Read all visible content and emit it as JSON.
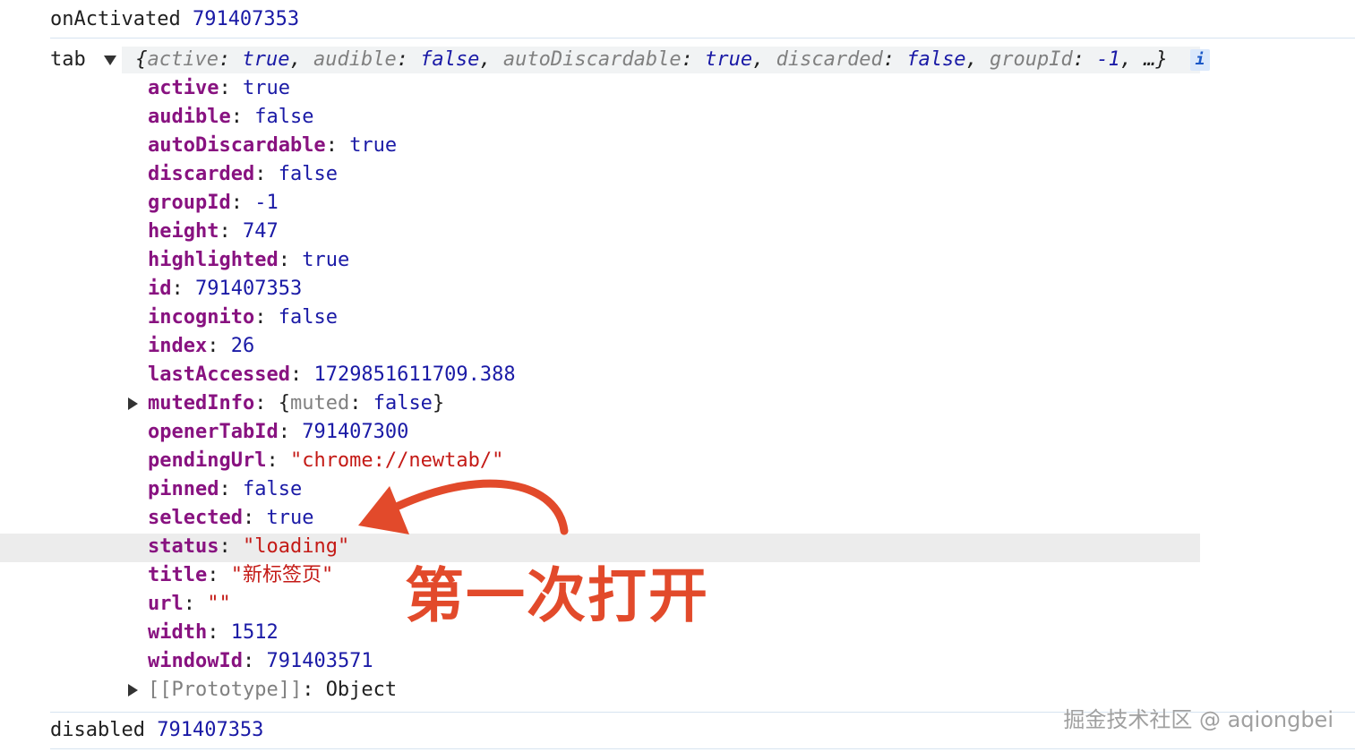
{
  "log": {
    "event1": {
      "label": "onActivated",
      "value": "791407353"
    },
    "tab_label": "tab",
    "preview": {
      "open": "{",
      "items": [
        {
          "k": "active",
          "v": "true"
        },
        {
          "k": "audible",
          "v": "false"
        },
        {
          "k": "autoDiscardable",
          "v": "true"
        },
        {
          "k": "discarded",
          "v": "false"
        },
        {
          "k": "groupId",
          "v": "-1"
        }
      ],
      "tail": "…}",
      "info_badge": "i"
    },
    "props": [
      {
        "key": "active",
        "value": "true",
        "type": "kw"
      },
      {
        "key": "audible",
        "value": "false",
        "type": "kw"
      },
      {
        "key": "autoDiscardable",
        "value": "true",
        "type": "kw"
      },
      {
        "key": "discarded",
        "value": "false",
        "type": "kw"
      },
      {
        "key": "groupId",
        "value": "-1",
        "type": "num"
      },
      {
        "key": "height",
        "value": "747",
        "type": "num"
      },
      {
        "key": "highlighted",
        "value": "true",
        "type": "kw"
      },
      {
        "key": "id",
        "value": "791407353",
        "type": "num"
      },
      {
        "key": "incognito",
        "value": "false",
        "type": "kw"
      },
      {
        "key": "index",
        "value": "26",
        "type": "num"
      },
      {
        "key": "lastAccessed",
        "value": "1729851611709.388",
        "type": "num"
      },
      {
        "key": "mutedInfo",
        "value": "",
        "type": "obj",
        "obj_open": "{",
        "obj_key": "muted",
        "obj_val": "false",
        "obj_close": "}"
      },
      {
        "key": "openerTabId",
        "value": "791407300",
        "type": "num"
      },
      {
        "key": "pendingUrl",
        "value": "\"chrome://newtab/\"",
        "type": "str"
      },
      {
        "key": "pinned",
        "value": "false",
        "type": "kw"
      },
      {
        "key": "selected",
        "value": "true",
        "type": "kw"
      },
      {
        "key": "status",
        "value": "\"loading\"",
        "type": "str"
      },
      {
        "key": "title",
        "value": "\"新标签页\"",
        "type": "str"
      },
      {
        "key": "url",
        "value": "\"\"",
        "type": "str"
      },
      {
        "key": "width",
        "value": "1512",
        "type": "num"
      },
      {
        "key": "windowId",
        "value": "791403571",
        "type": "num"
      }
    ],
    "prototype": {
      "key": "[[Prototype]]",
      "value": "Object"
    },
    "event2": {
      "label": "disabled",
      "value": "791407353"
    }
  },
  "annotation": {
    "text": "第一次打开",
    "color": "#e24a2b"
  },
  "watermark": "掘金技术社区 @ aqiongbei",
  "colors": {
    "number": "#1a1aa6",
    "string": "#c41a16",
    "key": "#881280",
    "separator": "#d6e3f0"
  }
}
